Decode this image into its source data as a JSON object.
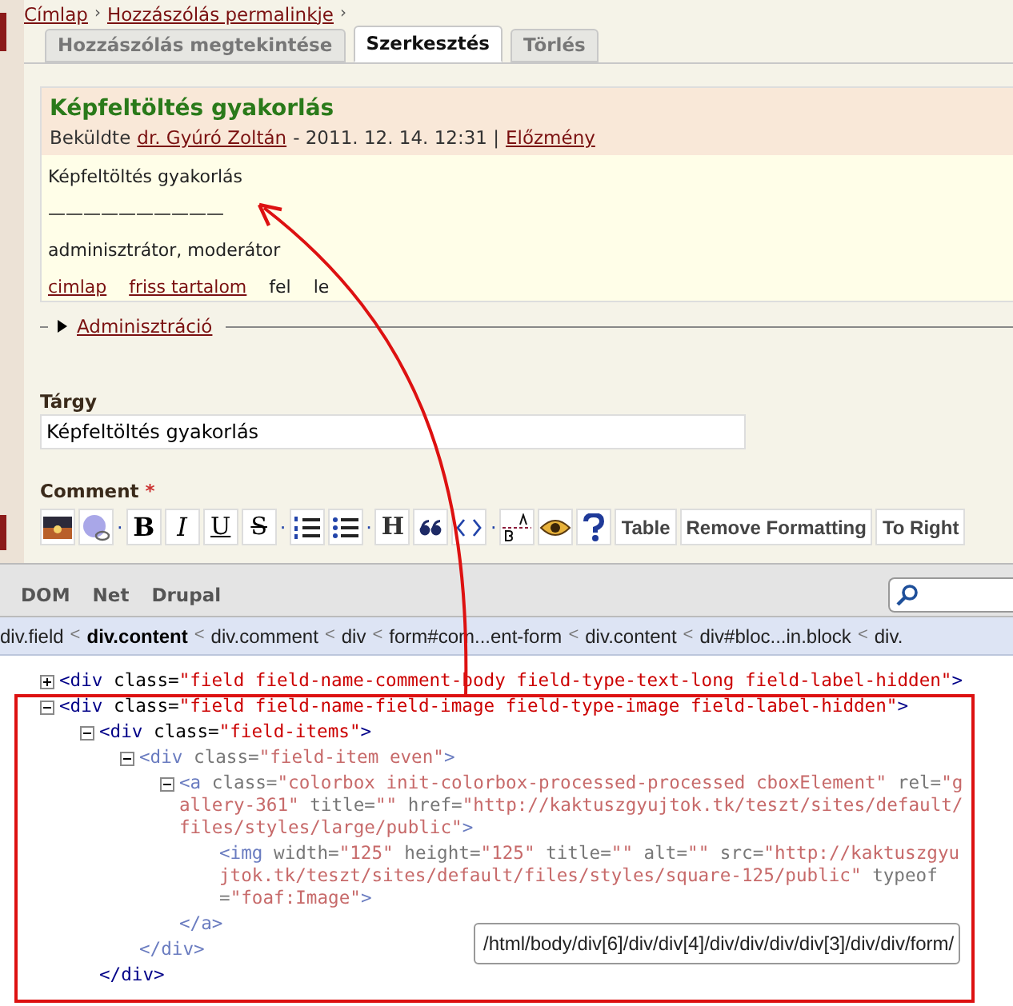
{
  "page": {
    "breadcrumb": {
      "separator": "›",
      "links": [
        "Címlap",
        "Hozzászólás permalinkje"
      ]
    },
    "tabs": [
      {
        "label": "Hozzászólás megtekintése",
        "selected": false
      },
      {
        "label": "Szerkesztés",
        "selected": true
      },
      {
        "label": "Törlés",
        "selected": false
      }
    ],
    "comment": {
      "title": "Képfeltöltés gyakorlás",
      "byline": "Beküldte",
      "author": "dr. Gyúró Zoltán",
      "date": "- 2011. 12. 14. 12:31 |",
      "history": "Előzmény",
      "body": [
        "Képfeltöltés gyakorlás",
        "——————————",
        "adminisztrátor, moderátor"
      ],
      "links": [
        {
          "label": "cimlap",
          "kind": "link"
        },
        {
          "label": "friss tartalom",
          "kind": "link"
        },
        {
          "label": "fel",
          "kind": "plain"
        },
        {
          "label": "le",
          "kind": "plain"
        }
      ]
    },
    "admin": {
      "label": "Adminisztráció",
      "expanded": false
    },
    "subject": {
      "label": "Tárgy",
      "value": "Képfeltöltés gyakorlás"
    },
    "comment_field": {
      "label": "Comment",
      "required_mark": "*"
    },
    "toolbar": [
      {
        "kind": "picture"
      },
      {
        "kind": "globe"
      },
      {
        "kind": "separator",
        "text": "·"
      },
      {
        "kind": "bold",
        "text": "B"
      },
      {
        "kind": "italic",
        "text": "I"
      },
      {
        "kind": "underline",
        "text": "U"
      },
      {
        "kind": "strike",
        "text": "S"
      },
      {
        "kind": "separator",
        "text": "·"
      },
      {
        "kind": "numbered"
      },
      {
        "kind": "bullets"
      },
      {
        "kind": "separator",
        "text": "·"
      },
      {
        "kind": "heading",
        "text": "H"
      },
      {
        "kind": "quote"
      },
      {
        "kind": "code"
      },
      {
        "kind": "separator",
        "text": "·"
      },
      {
        "kind": "supsub"
      },
      {
        "kind": "eye"
      },
      {
        "kind": "help"
      },
      {
        "kind": "text",
        "text": "Table"
      },
      {
        "kind": "text",
        "text": "Remove Formatting"
      },
      {
        "kind": "text",
        "text": "To Right"
      }
    ]
  },
  "devtools": {
    "tabs": [
      "DOM",
      "Net",
      "Drupal"
    ],
    "breadcrumb": {
      "separator": "<",
      "items": [
        {
          "label": "div.field",
          "selected": false
        },
        {
          "label": "div.content",
          "selected": true
        },
        {
          "label": "div.comment",
          "selected": false
        },
        {
          "label": "div",
          "selected": false
        },
        {
          "label": "form#com...ent-form",
          "selected": false
        },
        {
          "label": "div.content",
          "selected": false
        },
        {
          "label": "div#bloc...in.block",
          "selected": false
        },
        {
          "label": "div.",
          "selected": false
        }
      ]
    },
    "tree": [
      {
        "expanded": false,
        "dimmed": false,
        "text": "<div class=\"field field-name-comment-body field-type-text-long field-label-hidden\">"
      },
      {
        "expanded": true,
        "dimmed": false,
        "text": "<div class=\"field field-name-field-image field-type-image field-label-hidden\">",
        "children": [
          {
            "expanded": true,
            "dimmed": false,
            "text": "<div class=\"field-items\">",
            "close": "</div>",
            "children": [
              {
                "expanded": true,
                "dimmed": true,
                "text": "<div class=\"field-item even\">",
                "close": "</div>",
                "children": [
                  {
                    "expanded": true,
                    "dimmed": true,
                    "text": "<a class=\"colorbox init-colorbox-processed-processed cboxElement\" rel=\"gallery-361\" title=\"\" href=\"http://kaktuszgyujtok.tk/teszt/sites/default/files/styles/large/public\">",
                    "close": "</a>",
                    "children": [
                      {
                        "dimmed": true,
                        "text": "<img width=\"125\" height=\"125\" title=\"\" alt=\"\" src=\"http://kaktuszgyujtok.tk/teszt/sites/default/files/styles/square-125/public\" typeof=\"foaf:Image\">"
                      }
                    ]
                  }
                ]
              }
            ]
          }
        ]
      }
    ],
    "tooltip": "/html/body/div[6]/div/div[4]/div/div/div/div[3]/div/div/form/"
  }
}
